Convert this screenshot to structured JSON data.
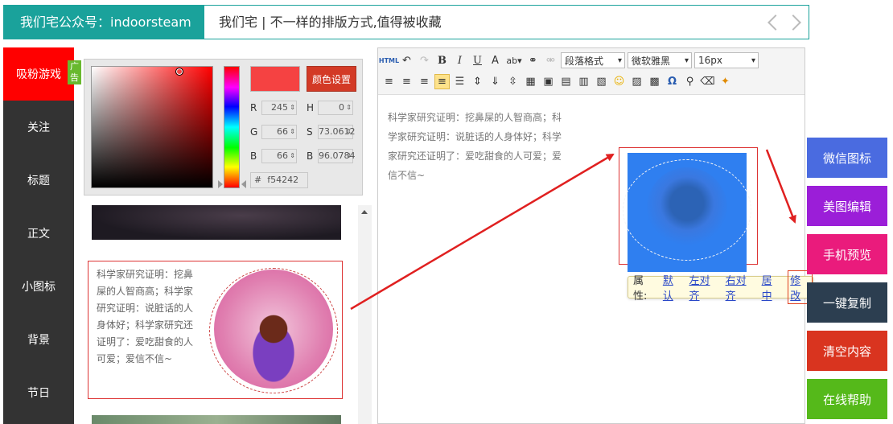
{
  "header": {
    "brand": "我们宅公众号：indoorsteam",
    "title": "我们宅 | 不一样的排版方式,值得被收藏"
  },
  "sidebar": {
    "ad_badge": "广告",
    "items": [
      {
        "label": "吸粉游戏",
        "active": true
      },
      {
        "label": "关注"
      },
      {
        "label": "标题"
      },
      {
        "label": "正文"
      },
      {
        "label": "小图标"
      },
      {
        "label": "背景"
      },
      {
        "label": "节日"
      }
    ]
  },
  "color_picker": {
    "swatch_color": "#f54242",
    "set_label": "颜色设置",
    "r_label": "R",
    "r": "245",
    "g_label": "G",
    "g": "66",
    "b_label": "B",
    "b": "66",
    "h_label": "H",
    "h": "0",
    "s_label": "S",
    "s": "73.0612",
    "b2_label": "B",
    "b2": "96.0784",
    "hex_label": "#",
    "hex": "f54242"
  },
  "template": {
    "text": "科学家研究证明：挖鼻屎的人智商高；科学家研究证明：说脏话的人身体好；科学家研究还证明了：爱吃甜食的人可爱；爱信不信~"
  },
  "toolbar": {
    "html_label": "HTML",
    "bold": "B",
    "italic": "I",
    "underline": "U",
    "font_color": "A",
    "paragraph_format": "段落格式",
    "font_family": "微软雅黑",
    "font_size": "16px",
    "omega": "Ω"
  },
  "editor": {
    "text": "科学家研究证明：挖鼻屎的人智商高；科学家研究证明：说脏话的人身体好；科学家研究还证明了：爱吃甜食的人可爱；爱信不信~",
    "popup": {
      "label": "属性:",
      "default": "默认",
      "left": "左对齐",
      "right": "右对齐",
      "center": "居中",
      "edit": "修改"
    }
  },
  "right_buttons": [
    {
      "label": "微信图标",
      "color": "#4a6be0"
    },
    {
      "label": "美图编辑",
      "color": "#9b1ed8"
    },
    {
      "label": "手机预览",
      "color": "#ea1b7c"
    },
    {
      "label": "一键复制",
      "color": "#2c3e50"
    },
    {
      "label": "清空内容",
      "color": "#d9341f"
    },
    {
      "label": "在线帮助",
      "color": "#55b91a"
    }
  ]
}
